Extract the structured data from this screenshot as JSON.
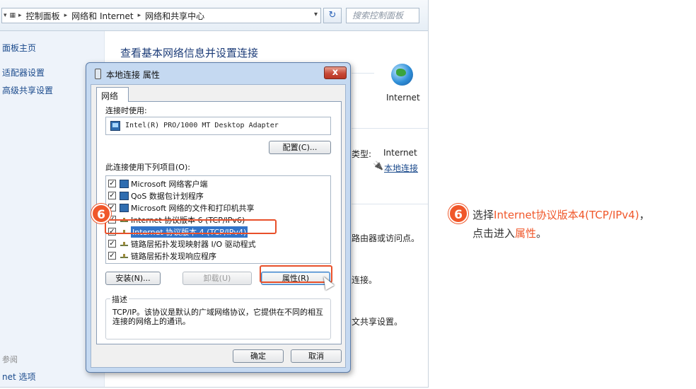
{
  "address_bar": {
    "breadcrumb": [
      "控制面板",
      "网络和 Internet",
      "网络和共享中心"
    ],
    "search_placeholder": "搜索控制面板"
  },
  "sidebar": {
    "links": [
      "面板主页",
      "适配器设置",
      "高级共享设置"
    ],
    "see_also_heading": "参阅",
    "see_also_link": "net 选项"
  },
  "main": {
    "title": "查看基本网络信息并设置连接",
    "internet_label": "Internet",
    "access_type_label": "类型:",
    "access_type_value": "Internet",
    "connection_link": "本地连接",
    "text_router": "路由器或访问点。",
    "text_connect": "连接。",
    "text_share": "文共享设置。"
  },
  "dialog": {
    "title": "本地连接 属性",
    "close_label": "x",
    "tab_label": "网络",
    "connect_using_label": "连接时使用:",
    "adapter_name": "Intel(R) PRO/1000 MT Desktop Adapter",
    "configure_button": "配置(C)...",
    "items_label": "此连接使用下列项目(O):",
    "items": [
      {
        "label": "Microsoft 网络客户端",
        "checked": true
      },
      {
        "label": "QoS 数据包计划程序",
        "checked": true
      },
      {
        "label": "Microsoft 网络的文件和打印机共享",
        "checked": true
      },
      {
        "label": "Internet 协议版本 6 (TCP/IPv6)",
        "checked": true
      },
      {
        "label": "Internet 协议版本 4 (TCP/IPv4)",
        "checked": true,
        "selected": true
      },
      {
        "label": "链路层拓扑发现映射器 I/O 驱动程式",
        "checked": true
      },
      {
        "label": "链路层拓扑发现响应程序",
        "checked": true
      }
    ],
    "install_button": "安装(N)...",
    "uninstall_button": "卸载(U)",
    "properties_button": "属性(R)",
    "description_title": "描述",
    "description_text": "TCP/IP。该协议是默认的广域网络协议，它提供在不同的相互连接的网络上的通讯。",
    "ok_button": "确定",
    "cancel_button": "取消"
  },
  "callout": {
    "step_number": "6",
    "line1_prefix": "选择",
    "line1_highlight": "Internet协议版本4(TCP/IPv4)",
    "line1_suffix": "，",
    "line2_prefix": "点击进入",
    "line2_highlight": "属性",
    "line2_suffix": "。"
  },
  "colors": {
    "accent": "#f0572a",
    "link": "#1a4a8c",
    "selection": "#3274c9"
  }
}
